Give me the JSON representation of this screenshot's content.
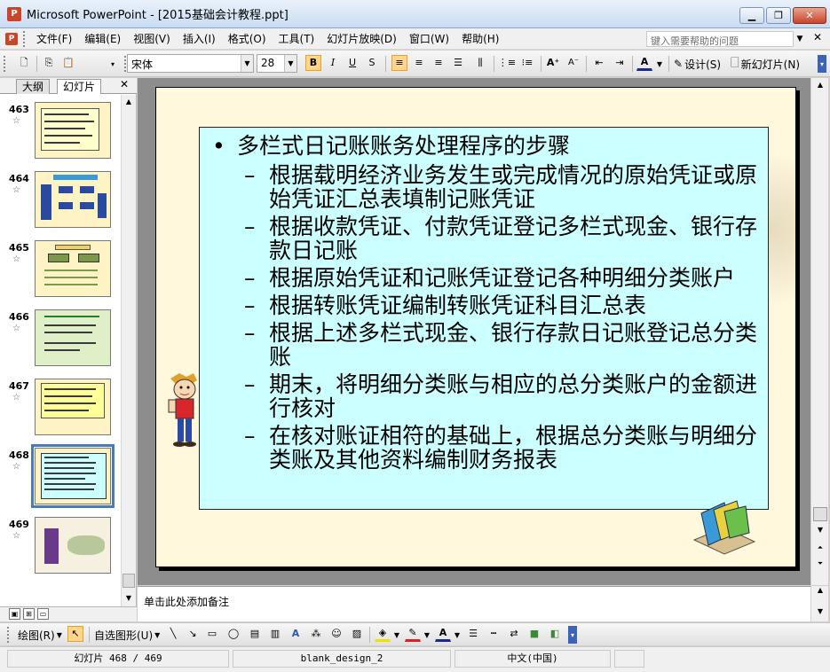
{
  "window": {
    "title": "Microsoft PowerPoint - [2015基础会计教程.ppt]",
    "app_icon": "P",
    "buttons": {
      "minimize": "▁",
      "restore": "❐",
      "close": "✕"
    }
  },
  "menu": {
    "items": [
      "文件(F)",
      "编辑(E)",
      "视图(V)",
      "插入(I)",
      "格式(O)",
      "工具(T)",
      "幻灯片放映(D)",
      "窗口(W)",
      "帮助(H)"
    ],
    "help_placeholder": "键入需要帮助的问题",
    "close_glyph": "✕"
  },
  "format_toolbar": {
    "font_name": "宋体",
    "font_size": "28",
    "bold": "B",
    "italic": "I",
    "underline": "U",
    "shadow": "S",
    "design_label": "设计(S)",
    "new_slide_label": "新幻灯片(N)"
  },
  "left_pane": {
    "tabs": [
      "大纲",
      "幻灯片"
    ],
    "active_tab": "幻灯片",
    "close_glyph": "✕",
    "thumbnails": [
      {
        "num": "463",
        "star": "☆"
      },
      {
        "num": "464",
        "star": "☆"
      },
      {
        "num": "465",
        "star": "☆"
      },
      {
        "num": "466",
        "star": "☆"
      },
      {
        "num": "467",
        "star": "☆"
      },
      {
        "num": "468",
        "star": "☆"
      },
      {
        "num": "469",
        "star": "☆"
      }
    ],
    "selected": "468"
  },
  "slide": {
    "heading": "多栏式日记账账务处理程序的步骤",
    "items": [
      "根据载明经济业务发生或完成情况的原始凭证或原始凭证汇总表填制记账凭证",
      "根据收款凭证、付款凭证登记多栏式现金、银行存款日记账",
      "根据原始凭证和记账凭证登记各种明细分类账户",
      "根据转账凭证编制转账凭证科目汇总表",
      "根据上述多栏式现金、银行存款日记账登记总分类账",
      "期末，将明细分类账与相应的总分类账户的金额进行核对",
      "在核对账证相符的基础上，根据总分类账与明细分类账及其他资料编制财务报表"
    ]
  },
  "notes": {
    "placeholder": "单击此处添加备注"
  },
  "drawing_toolbar": {
    "draw_label": "绘图(R)",
    "autoshapes_label": "自选图形(U)"
  },
  "status": {
    "slide_pos": "幻灯片 468 / 469",
    "design": "blank_design_2",
    "language": "中文(中国)"
  }
}
